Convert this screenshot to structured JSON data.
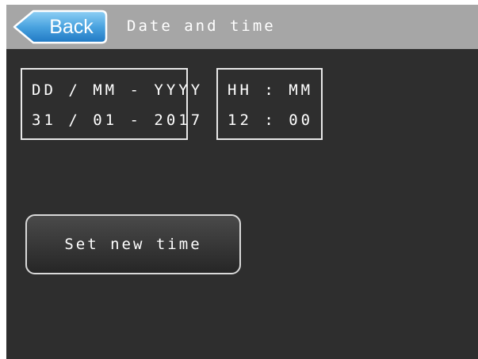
{
  "header": {
    "back_label": "Back",
    "title": "Date and time"
  },
  "date_display": {
    "format_label": "DD / MM - YYYY",
    "value": "31 / 01 - 2017"
  },
  "time_display": {
    "format_label": "HH : MM",
    "value": "12 : 00"
  },
  "actions": {
    "set_new_time_label": "Set new time"
  },
  "colors": {
    "header_background": "#a6a6a6",
    "screen_background": "#2e2e2e",
    "back_button_fill": "#4aa3df",
    "back_button_outline": "#ffffff",
    "text": "#ffffff",
    "box_border": "#e8e8e8"
  },
  "icons": {
    "back": "back-arrow-shape"
  }
}
